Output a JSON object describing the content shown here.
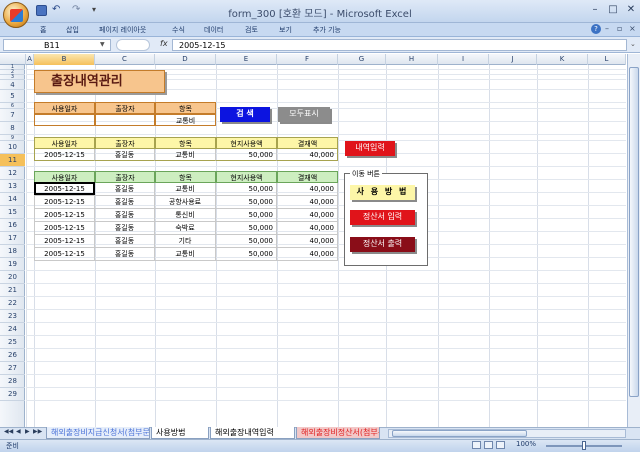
{
  "app": {
    "title": "form_300  [호환 모드] - Microsoft Excel",
    "undo": "↶",
    "redo": "↷",
    "qa_more": "▾",
    "win_min": "–",
    "win_max": "□",
    "win_close": "✕"
  },
  "ribbon": {
    "tabs": [
      "홈",
      "삽입",
      "페이지 레이아웃",
      "수식",
      "데이터",
      "검토",
      "보기",
      "추가 기능"
    ],
    "help": "?",
    "min": "–",
    "restore": "▫",
    "close": "×"
  },
  "formula_bar": {
    "name_box": "B11",
    "fx": "fx",
    "value": "2005-12-15"
  },
  "columns": [
    "A",
    "B",
    "C",
    "D",
    "E",
    "F",
    "G",
    "H",
    "I",
    "J",
    "K",
    "L"
  ],
  "selected_column": "B",
  "rows": [
    "1",
    "2",
    "3",
    "4",
    "5",
    "6",
    "7",
    "8",
    "9",
    "10",
    "11",
    "12",
    "13",
    "14",
    "15",
    "16",
    "17",
    "18",
    "19",
    "20",
    "21",
    "22",
    "23",
    "24",
    "25",
    "26",
    "27",
    "28",
    "29"
  ],
  "selected_row": "11",
  "sheet": {
    "banner": "출장내역관리",
    "search_header": [
      "사용일자",
      "출장자",
      "항목"
    ],
    "search_values": [
      "",
      "",
      "교통비"
    ],
    "buttons": {
      "search": "검 색",
      "show_all": "모두표시",
      "input": "내역입력"
    },
    "entry_header": [
      "사용일자",
      "출장자",
      "항목",
      "현지사용액",
      "결재액"
    ],
    "entry_row": [
      "2005-12-15",
      "홍길동",
      "교통비",
      "50,000",
      "40,000"
    ],
    "list_header": [
      "사용일자",
      "출장자",
      "항목",
      "현지사용액",
      "결재액"
    ],
    "list_rows": [
      [
        "2005-12-15",
        "홍길동",
        "교통비",
        "50,000",
        "40,000"
      ],
      [
        "2005-12-15",
        "홍길동",
        "공항사용료",
        "50,000",
        "40,000"
      ],
      [
        "2005-12-15",
        "홍길동",
        "통신비",
        "50,000",
        "40,000"
      ],
      [
        "2005-12-15",
        "홍길동",
        "숙박료",
        "50,000",
        "40,000"
      ],
      [
        "2005-12-15",
        "홍길동",
        "기타",
        "50,000",
        "40,000"
      ],
      [
        "2005-12-15",
        "홍길동",
        "교통비",
        "50,000",
        "40,000"
      ]
    ],
    "move_group": {
      "label": "이동 버튼",
      "usage": "사 용 방 법",
      "settle_input": "정산서 입력",
      "settle_output": "정산서 출력"
    }
  },
  "sheet_tabs": {
    "nav": [
      "◀◀",
      "◀",
      "▶",
      "▶▶"
    ],
    "tabs": [
      "해외출장비지급신청서(첨부문서)",
      "사용방법",
      "해외출장내역입력",
      "해외출장비정산서(첨부문서)"
    ],
    "active": "해외출장내역입력"
  },
  "status": {
    "ready": "준비",
    "zoom": "100%",
    "zoom_level": 0.5
  }
}
